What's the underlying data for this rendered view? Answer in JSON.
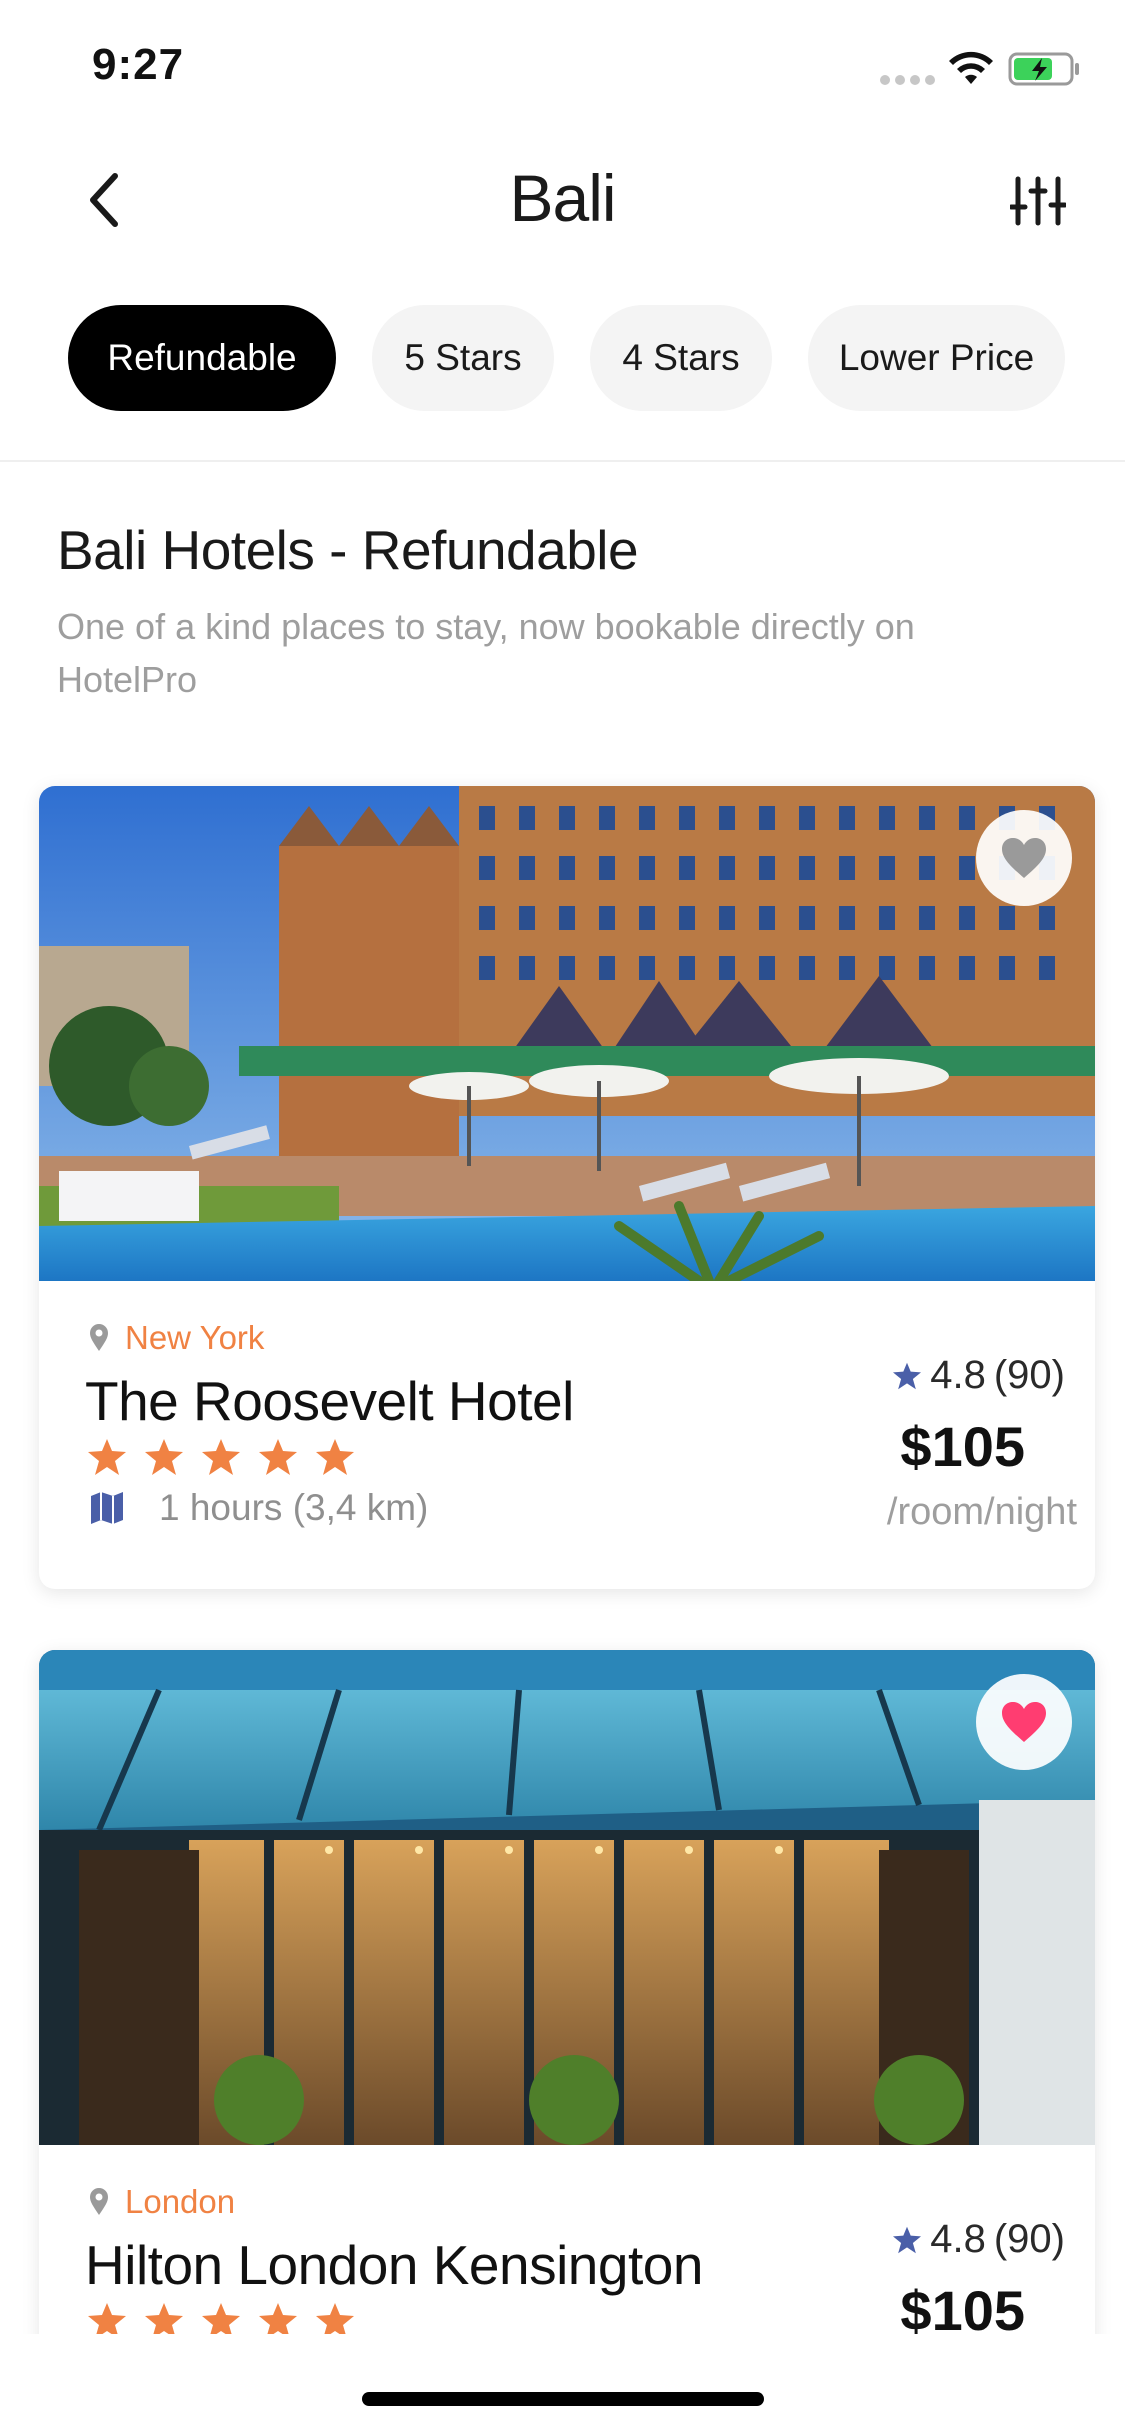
{
  "status_bar": {
    "time": "9:27",
    "icons": [
      "signal-icon",
      "wifi-icon",
      "battery-charging-icon"
    ]
  },
  "nav": {
    "title": "Bali",
    "back_icon": "chevron-left-icon",
    "filter_icon": "sliders-icon"
  },
  "filters": [
    {
      "label": "Refundable",
      "active": true
    },
    {
      "label": "5 Stars",
      "active": false
    },
    {
      "label": "4 Stars",
      "active": false
    },
    {
      "label": "Lower Price",
      "active": false
    }
  ],
  "section": {
    "title": "Bali Hotels  - Refundable",
    "subtitle": "One of a kind places to stay, now bookable directly on HotelPro"
  },
  "hotels": [
    {
      "location": "New York",
      "name": "The Roosevelt Hotel",
      "stars": 5,
      "distance": "1 hours (3,4 km)",
      "rating": "4.8",
      "reviews": "(90)",
      "price": "$105",
      "per": "/room/night",
      "favorite": false
    },
    {
      "location": "London",
      "name": "Hilton London Kensington",
      "stars": 5,
      "rating": "4.8",
      "reviews": "(90)",
      "price": "$105",
      "favorite": true
    }
  ],
  "colors": {
    "accent": "#f08243",
    "star": "#f08243",
    "rating_star": "#4a5fa8",
    "favorite_active": "#ff3d71",
    "favorite_inactive": "#9a9a9a"
  }
}
